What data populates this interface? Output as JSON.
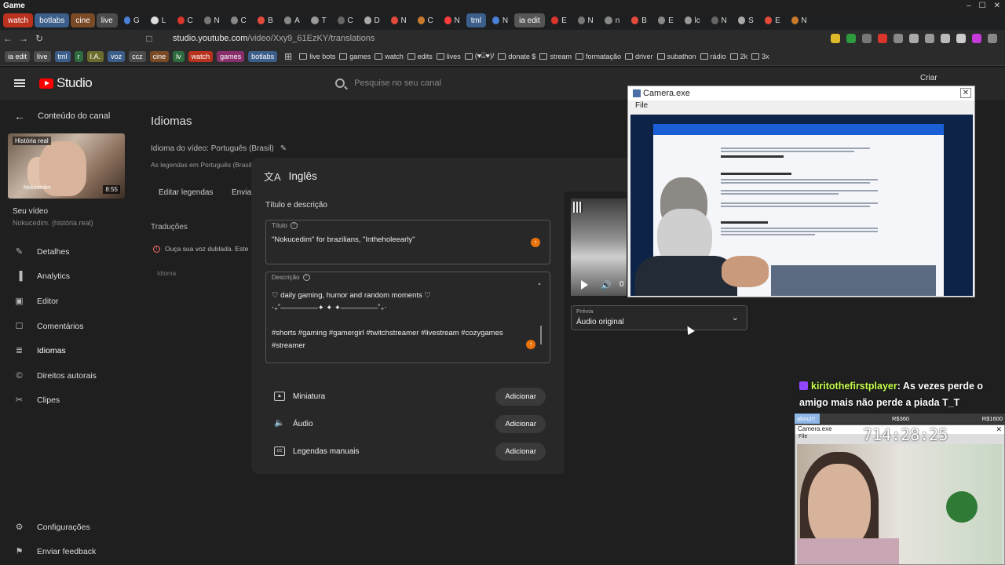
{
  "os": {
    "title": "Game",
    "controls": [
      "–",
      "☐",
      "✕"
    ]
  },
  "tabs": [
    {
      "label": "watch",
      "color": "#b8321e"
    },
    {
      "label": "botlabs",
      "color": "#3b5e8a"
    },
    {
      "label": "cine",
      "color": "#7a4a26"
    },
    {
      "label": "live",
      "color": "#4b4b4b"
    },
    {
      "label": "G",
      "color": ""
    },
    {
      "label": "L",
      "color": ""
    },
    {
      "label": "C",
      "color": ""
    },
    {
      "label": "N",
      "color": ""
    },
    {
      "label": "C",
      "color": ""
    },
    {
      "label": "B",
      "color": ""
    },
    {
      "label": "A",
      "color": ""
    },
    {
      "label": "T",
      "color": ""
    },
    {
      "label": "C",
      "color": ""
    },
    {
      "label": "D",
      "color": ""
    },
    {
      "label": "N",
      "color": ""
    },
    {
      "label": "C",
      "color": ""
    },
    {
      "label": "N",
      "color": ""
    },
    {
      "label": "tml",
      "color": "#3b5e8a"
    },
    {
      "label": "N",
      "color": ""
    },
    {
      "label": "ia edit",
      "color": "#555555"
    },
    {
      "label": "E",
      "color": ""
    },
    {
      "label": "N",
      "color": ""
    },
    {
      "label": "n",
      "color": ""
    },
    {
      "label": "B",
      "color": ""
    },
    {
      "label": "E",
      "color": ""
    },
    {
      "label": "lc",
      "color": ""
    },
    {
      "label": "N",
      "color": ""
    },
    {
      "label": "S",
      "color": ""
    },
    {
      "label": "E",
      "color": ""
    },
    {
      "label": "N",
      "color": ""
    }
  ],
  "address": {
    "url_host": "studio.youtube.com",
    "url_path": "/video/Xxy9_61EzKY/translations"
  },
  "bookmarks_chips": [
    {
      "label": "ia edit",
      "color": "#4b4b4b"
    },
    {
      "label": "live",
      "color": "#4b4b4b"
    },
    {
      "label": "tml",
      "color": "#3b5e8a"
    },
    {
      "label": "r",
      "color": "#2e6b3e"
    },
    {
      "label": "I.A.",
      "color": "#6b6b2e"
    },
    {
      "label": "voz",
      "color": "#3b5e8a"
    },
    {
      "label": "ccz",
      "color": "#4b4b4b"
    },
    {
      "label": "cine",
      "color": "#7a4a26"
    },
    {
      "label": "lv",
      "color": "#2e6b3e"
    },
    {
      "label": "watch",
      "color": "#b8321e"
    },
    {
      "label": "games",
      "color": "#8a2e6b"
    },
    {
      "label": "botlabs",
      "color": "#3b5e8a"
    }
  ],
  "bookmarks": [
    "live bots",
    "games",
    "watch",
    "edits",
    "lives",
    "(♥⌺♥)/",
    "donate $",
    "stream",
    "formatação",
    "driver",
    "subathon",
    "rádio",
    "2k",
    "3x"
  ],
  "studio": {
    "logo": "Studio",
    "search_placeholder": "Pesquise no seu canal",
    "create": "Criar"
  },
  "sidebar": {
    "back_label": "Conteúdo do canal",
    "thumb_caption": "História real",
    "thumb_caption2": "Nokucedim",
    "thumb_duration": "8:55",
    "your_video": "Seu vídeo",
    "your_video_sub": "Nokucedim. (história real)",
    "items": [
      {
        "label": "Detalhes",
        "icon": "✎"
      },
      {
        "label": "Analytics",
        "icon": "▐"
      },
      {
        "label": "Editor",
        "icon": "▣"
      },
      {
        "label": "Comentários",
        "icon": "☐"
      },
      {
        "label": "Idiomas",
        "icon": "≣"
      },
      {
        "label": "Direitos autorais",
        "icon": "©"
      },
      {
        "label": "Clipes",
        "icon": "✂"
      }
    ],
    "bottom": [
      {
        "label": "Configurações",
        "icon": "⚙"
      },
      {
        "label": "Enviar feedback",
        "icon": "⚑"
      }
    ]
  },
  "main": {
    "title": "Idiomas",
    "video_language": "Idioma do vídeo: Português (Brasil)",
    "subs_line": "As legendas em Português (Brasil) s",
    "edit_subs": "Editar legendas",
    "send": "Enviar",
    "translations": "Traduções",
    "warning": "Ouça sua voz dublada. Este",
    "lang_col": "Idioma"
  },
  "modal": {
    "title": "Inglês",
    "section": "Título e descrição",
    "title_label": "Título",
    "title_value": "\"Nokucedim\" for brazilians, \"Intheholeearly\"",
    "desc_label": "Descrição",
    "desc_value": "♡ daily gaming, humor and random moments ♡\n‧₊˚—————✦ ✦ ✦—————˚₊‧\n\n#shorts #gaming #gamergirl #twitchstreamer #livestream #cozygames\n#streamer",
    "rows": [
      {
        "label": "Miniatura",
        "button": "Adicionar"
      },
      {
        "label": "Áudio",
        "button": "Adicionar"
      },
      {
        "label": "Legendas manuais",
        "button": "Adicionar"
      }
    ],
    "preview_label": "Prévia",
    "preview_value": "Áudio original",
    "preview_time": "0"
  },
  "camera": {
    "title": "Camera.exe",
    "menu": "File"
  },
  "chat": {
    "user": "kiritothefirstplayer",
    "message": ": As vezes perde o amigo mais não perde a piada T_T"
  },
  "goal": {
    "left": "abriu!!!",
    "mid": "R$360",
    "right": "R$1600",
    "progress": 0.12
  },
  "cam2": {
    "title": "Camera.exe",
    "menu": "File",
    "timer": "714:28:25"
  }
}
